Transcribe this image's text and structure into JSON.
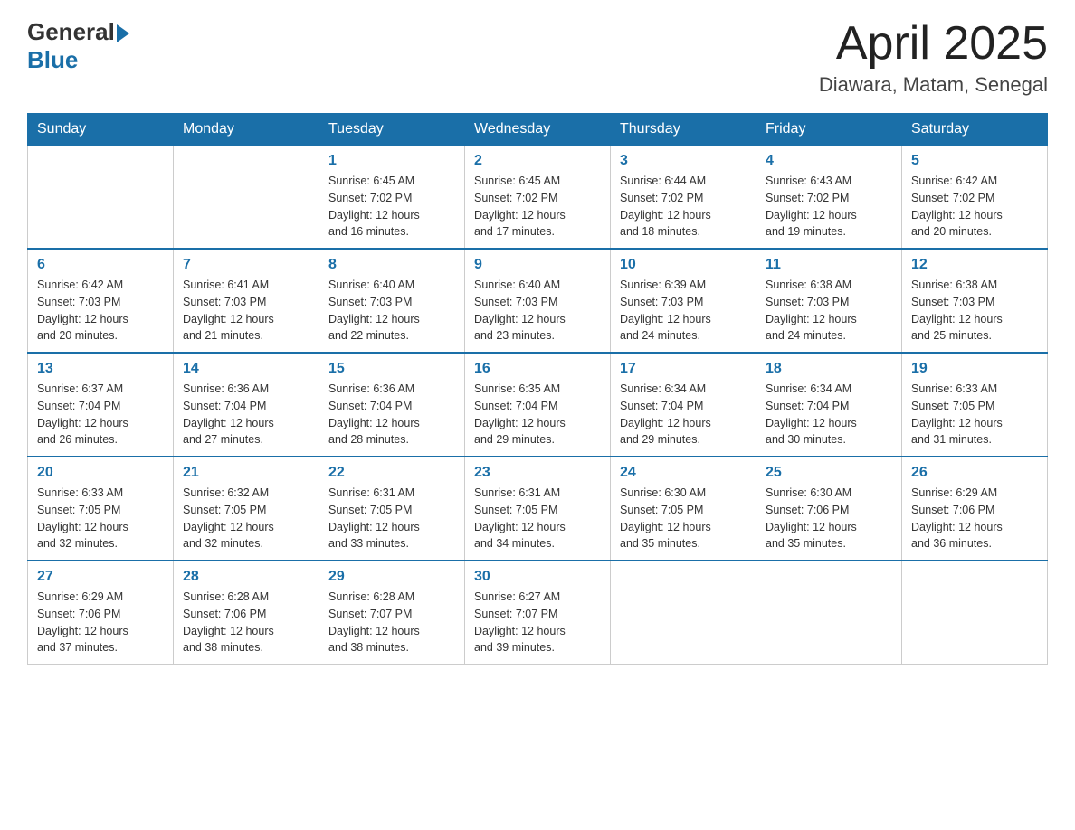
{
  "header": {
    "logo_general": "General",
    "logo_blue": "Blue",
    "month": "April 2025",
    "location": "Diawara, Matam, Senegal"
  },
  "days_of_week": [
    "Sunday",
    "Monday",
    "Tuesday",
    "Wednesday",
    "Thursday",
    "Friday",
    "Saturday"
  ],
  "weeks": [
    [
      {
        "day": "",
        "info": ""
      },
      {
        "day": "",
        "info": ""
      },
      {
        "day": "1",
        "info": "Sunrise: 6:45 AM\nSunset: 7:02 PM\nDaylight: 12 hours\nand 16 minutes."
      },
      {
        "day": "2",
        "info": "Sunrise: 6:45 AM\nSunset: 7:02 PM\nDaylight: 12 hours\nand 17 minutes."
      },
      {
        "day": "3",
        "info": "Sunrise: 6:44 AM\nSunset: 7:02 PM\nDaylight: 12 hours\nand 18 minutes."
      },
      {
        "day": "4",
        "info": "Sunrise: 6:43 AM\nSunset: 7:02 PM\nDaylight: 12 hours\nand 19 minutes."
      },
      {
        "day": "5",
        "info": "Sunrise: 6:42 AM\nSunset: 7:02 PM\nDaylight: 12 hours\nand 20 minutes."
      }
    ],
    [
      {
        "day": "6",
        "info": "Sunrise: 6:42 AM\nSunset: 7:03 PM\nDaylight: 12 hours\nand 20 minutes."
      },
      {
        "day": "7",
        "info": "Sunrise: 6:41 AM\nSunset: 7:03 PM\nDaylight: 12 hours\nand 21 minutes."
      },
      {
        "day": "8",
        "info": "Sunrise: 6:40 AM\nSunset: 7:03 PM\nDaylight: 12 hours\nand 22 minutes."
      },
      {
        "day": "9",
        "info": "Sunrise: 6:40 AM\nSunset: 7:03 PM\nDaylight: 12 hours\nand 23 minutes."
      },
      {
        "day": "10",
        "info": "Sunrise: 6:39 AM\nSunset: 7:03 PM\nDaylight: 12 hours\nand 24 minutes."
      },
      {
        "day": "11",
        "info": "Sunrise: 6:38 AM\nSunset: 7:03 PM\nDaylight: 12 hours\nand 24 minutes."
      },
      {
        "day": "12",
        "info": "Sunrise: 6:38 AM\nSunset: 7:03 PM\nDaylight: 12 hours\nand 25 minutes."
      }
    ],
    [
      {
        "day": "13",
        "info": "Sunrise: 6:37 AM\nSunset: 7:04 PM\nDaylight: 12 hours\nand 26 minutes."
      },
      {
        "day": "14",
        "info": "Sunrise: 6:36 AM\nSunset: 7:04 PM\nDaylight: 12 hours\nand 27 minutes."
      },
      {
        "day": "15",
        "info": "Sunrise: 6:36 AM\nSunset: 7:04 PM\nDaylight: 12 hours\nand 28 minutes."
      },
      {
        "day": "16",
        "info": "Sunrise: 6:35 AM\nSunset: 7:04 PM\nDaylight: 12 hours\nand 29 minutes."
      },
      {
        "day": "17",
        "info": "Sunrise: 6:34 AM\nSunset: 7:04 PM\nDaylight: 12 hours\nand 29 minutes."
      },
      {
        "day": "18",
        "info": "Sunrise: 6:34 AM\nSunset: 7:04 PM\nDaylight: 12 hours\nand 30 minutes."
      },
      {
        "day": "19",
        "info": "Sunrise: 6:33 AM\nSunset: 7:05 PM\nDaylight: 12 hours\nand 31 minutes."
      }
    ],
    [
      {
        "day": "20",
        "info": "Sunrise: 6:33 AM\nSunset: 7:05 PM\nDaylight: 12 hours\nand 32 minutes."
      },
      {
        "day": "21",
        "info": "Sunrise: 6:32 AM\nSunset: 7:05 PM\nDaylight: 12 hours\nand 32 minutes."
      },
      {
        "day": "22",
        "info": "Sunrise: 6:31 AM\nSunset: 7:05 PM\nDaylight: 12 hours\nand 33 minutes."
      },
      {
        "day": "23",
        "info": "Sunrise: 6:31 AM\nSunset: 7:05 PM\nDaylight: 12 hours\nand 34 minutes."
      },
      {
        "day": "24",
        "info": "Sunrise: 6:30 AM\nSunset: 7:05 PM\nDaylight: 12 hours\nand 35 minutes."
      },
      {
        "day": "25",
        "info": "Sunrise: 6:30 AM\nSunset: 7:06 PM\nDaylight: 12 hours\nand 35 minutes."
      },
      {
        "day": "26",
        "info": "Sunrise: 6:29 AM\nSunset: 7:06 PM\nDaylight: 12 hours\nand 36 minutes."
      }
    ],
    [
      {
        "day": "27",
        "info": "Sunrise: 6:29 AM\nSunset: 7:06 PM\nDaylight: 12 hours\nand 37 minutes."
      },
      {
        "day": "28",
        "info": "Sunrise: 6:28 AM\nSunset: 7:06 PM\nDaylight: 12 hours\nand 38 minutes."
      },
      {
        "day": "29",
        "info": "Sunrise: 6:28 AM\nSunset: 7:07 PM\nDaylight: 12 hours\nand 38 minutes."
      },
      {
        "day": "30",
        "info": "Sunrise: 6:27 AM\nSunset: 7:07 PM\nDaylight: 12 hours\nand 39 minutes."
      },
      {
        "day": "",
        "info": ""
      },
      {
        "day": "",
        "info": ""
      },
      {
        "day": "",
        "info": ""
      }
    ]
  ]
}
